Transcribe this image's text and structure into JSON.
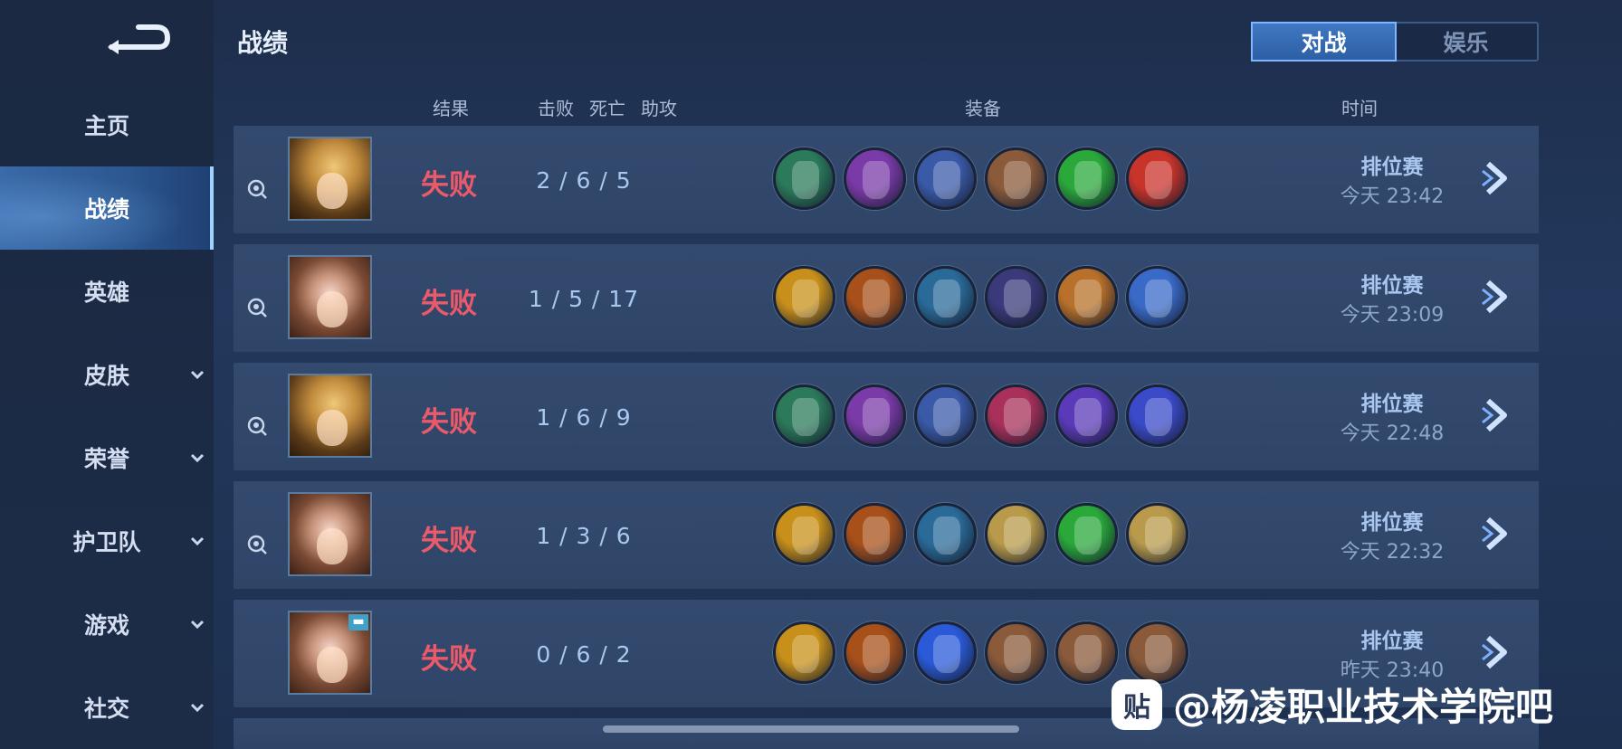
{
  "header": {
    "title": "战绩"
  },
  "tabs": [
    {
      "label": "对战",
      "active": true
    },
    {
      "label": "娱乐",
      "active": false
    }
  ],
  "sidebar": {
    "items": [
      {
        "label": "主页",
        "active": false,
        "has_dropdown": false
      },
      {
        "label": "战绩",
        "active": true,
        "has_dropdown": false
      },
      {
        "label": "英雄",
        "active": false,
        "has_dropdown": false
      },
      {
        "label": "皮肤",
        "active": false,
        "has_dropdown": true
      },
      {
        "label": "荣誉",
        "active": false,
        "has_dropdown": true
      },
      {
        "label": "护卫队",
        "active": false,
        "has_dropdown": true
      },
      {
        "label": "游戏",
        "active": false,
        "has_dropdown": true
      },
      {
        "label": "社交",
        "active": false,
        "has_dropdown": true
      }
    ]
  },
  "columns": {
    "result": "结果",
    "kills": "击败",
    "deaths": "死亡",
    "assists": "助攻",
    "equipment": "装备",
    "time": "时间"
  },
  "matches": [
    {
      "hero": "male-gold",
      "result": "失败",
      "kda": "2  /  6  /  5",
      "type": "排位赛",
      "time": "今天 23:42",
      "items": [
        "#2b7a5a",
        "#7a3aa8",
        "#3a5aa8",
        "#8a5a3a",
        "#2aa83a",
        "#c8332a"
      ]
    },
    {
      "hero": "female",
      "result": "失败",
      "kda": "1  /  5  /  17",
      "type": "排位赛",
      "time": "今天 23:09",
      "items": [
        "#c8901a",
        "#a8501a",
        "#2a6a98",
        "#3a3a7a",
        "#b8702a",
        "#3a6ac8"
      ]
    },
    {
      "hero": "male-gold",
      "result": "失败",
      "kda": "1  /  6  /  9",
      "type": "排位赛",
      "time": "今天 22:48",
      "items": [
        "#2b7a5a",
        "#7a3aa8",
        "#3a5aa8",
        "#a8305a",
        "#5a3ab8",
        "#3a4ac8"
      ]
    },
    {
      "hero": "female",
      "result": "失败",
      "kda": "1  /  3  /  6",
      "type": "排位赛",
      "time": "今天 22:32",
      "items": [
        "#c8901a",
        "#a8501a",
        "#2a6a98",
        "#b89a4a",
        "#2aa83a",
        "#b89a4a"
      ]
    },
    {
      "hero": "female-badge",
      "result": "失败",
      "kda": "0  /  6  /  2",
      "type": "排位赛",
      "time": "昨天 23:40",
      "items": [
        "#c8901a",
        "#a8501a",
        "#2a5ad8",
        "#8a5a3a",
        "#8a5a3a",
        "#8a5a3a"
      ]
    }
  ],
  "watermark": {
    "text": "@杨凌职业技术学院吧",
    "logo": "贴"
  }
}
